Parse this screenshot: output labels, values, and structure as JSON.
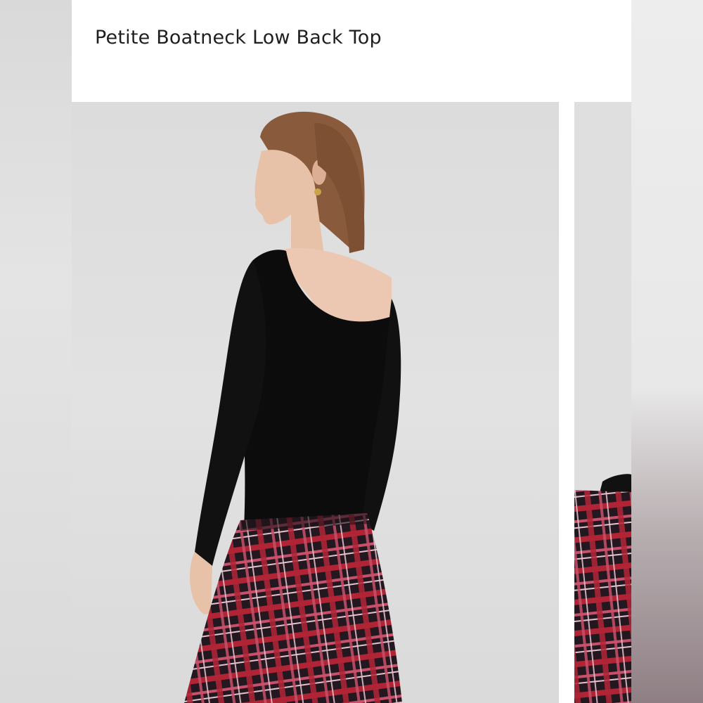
{
  "product": {
    "title": "Petite Boatneck Low Back Top"
  },
  "gallery": {
    "images": [
      {
        "description_icon": "model-photo-icon"
      },
      {
        "description_icon": "model-photo-icon"
      }
    ]
  },
  "colors": {
    "top": "#0c0c0c",
    "plaid_base": "#2a1a22",
    "plaid_red": "#c2283a",
    "plaid_pink": "#d9a3b6",
    "background": "#dedede"
  }
}
